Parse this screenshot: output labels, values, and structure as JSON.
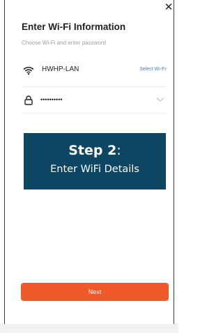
{
  "header": {
    "close_glyph": "✕",
    "title": "Enter Wi-Fi Information",
    "subtitle": "Choose Wi-Fi and enter password"
  },
  "wifi_row": {
    "icon": "wifi-icon",
    "ssid": "HWHP-LAN",
    "select_label": "Select Wi-Fi"
  },
  "password_row": {
    "icon": "lock-icon",
    "value": "••••••••••",
    "toggle_icon": "chevron-down-icon"
  },
  "banner": {
    "step_bold": "Step 2",
    "step_colon": ":",
    "subtitle": "Enter WiFi Details",
    "background": "#0c4663"
  },
  "footer": {
    "next_label": "Next",
    "accent": "#f05a2b"
  }
}
